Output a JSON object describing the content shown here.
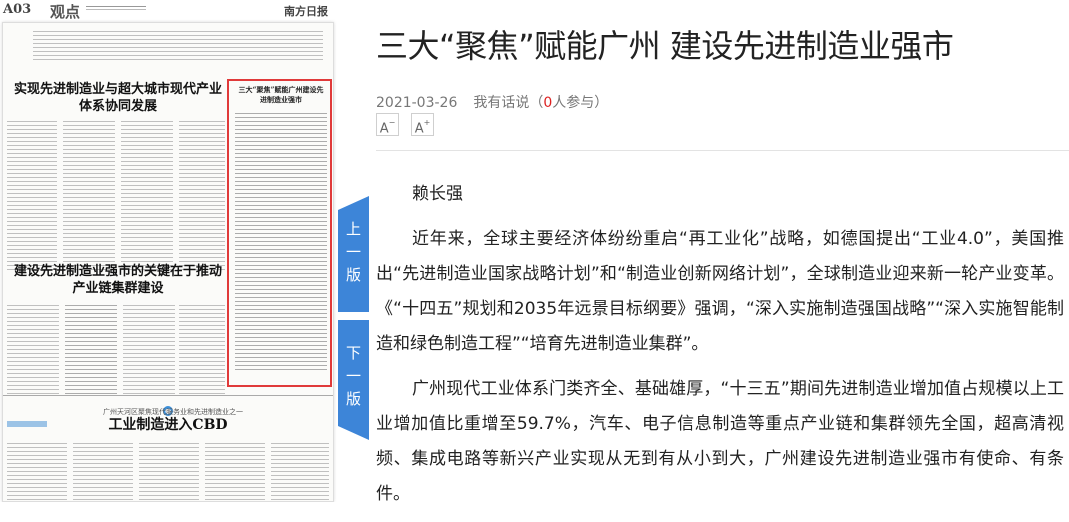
{
  "paper": {
    "edition": "A03",
    "section": "观点",
    "brand": "南方日报",
    "headline_1": "实现先进制造业与超大城市现代产业体系协同发展",
    "headline_2": "建设先进制造业强市的关键在于推动产业链集群建设",
    "box_headline": "三大“聚焦”赋能广州建设先进制造业强市",
    "bottom_headline_small": "广州天河区聚焦现代服务业和先进制造业之一",
    "bottom_headline": "工业制造进入CBD"
  },
  "nav": {
    "prev_label": [
      "上",
      "一",
      "版"
    ],
    "next_label": [
      "下",
      "一",
      "版"
    ]
  },
  "article": {
    "title": "三大“聚焦”赋能广州 建设先进制造业强市",
    "date": "2021-03-26",
    "comment_label": "我有话说",
    "participants_prefix": "（",
    "participants_count": "0",
    "participants_suffix": "人参与）",
    "font_decrease": "A",
    "font_increase": "A",
    "author": "赖长强",
    "paragraphs": [
      "近年来，全球主要经济体纷纷重启“再工业化”战略，如德国提出“工业4.0”，美国推出“先进制造业国家战略计划”和“制造业创新网络计划”，全球制造业迎来新一轮产业变革。《“十四五”规划和2035年远景目标纲要》强调，“深入实施制造强国战略”“深入实施智能制造和绿色制造工程”“培育先进制造业集群”。",
      "广州现代工业体系门类齐全、基础雄厚，“十三五”期间先进制造业增加值占规模以上工业增加值比重增至59.7%，汽车、电子信息制造等重点产业链和集群领先全国，超高清视频、集成电路等新兴产业实现从无到有从小到大，广州建设先进制造业强市有使命、有条件。"
    ]
  }
}
